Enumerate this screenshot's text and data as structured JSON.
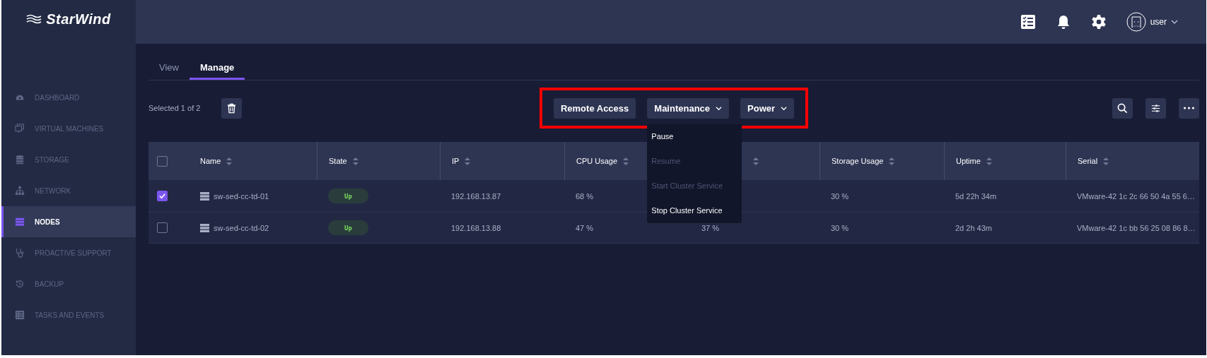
{
  "app": {
    "logo": "StarWind"
  },
  "top_bar": {
    "user": "user"
  },
  "sidebar": {
    "items": [
      {
        "label": "DASHBOARD",
        "kind": "dashboard",
        "selected": false
      },
      {
        "label": "VIRTUAL MACHINES",
        "kind": "monitors",
        "selected": false
      },
      {
        "label": "STORAGE",
        "kind": "database",
        "selected": false
      },
      {
        "label": "NETWORK",
        "kind": "network",
        "selected": false
      },
      {
        "label": "NODES",
        "kind": "server",
        "selected": true
      },
      {
        "label": "PROACTIVE SUPPORT",
        "kind": "stethoscope",
        "selected": false
      },
      {
        "label": "BACKUP",
        "kind": "history",
        "selected": false
      },
      {
        "label": "TASKS AND EVENTS",
        "kind": "list",
        "selected": false
      }
    ]
  },
  "tabs": [
    {
      "label": "View",
      "selected": false
    },
    {
      "label": "Manage",
      "selected": true
    }
  ],
  "toolbar": {
    "selection": "Selected 1 of 2",
    "actions": [
      {
        "label": "Remote Access",
        "kind": "plain"
      },
      {
        "label": "Maintenance",
        "kind": "dropdown",
        "menu": [
          {
            "label": "Pause",
            "disabled": false
          },
          {
            "label": "Resume",
            "disabled": true
          },
          {
            "label": "Start Cluster Service",
            "disabled": true
          },
          {
            "label": "Stop Cluster Service",
            "disabled": false
          }
        ]
      },
      {
        "label": "Power",
        "kind": "dropdown"
      }
    ]
  },
  "table": {
    "all_checked": false,
    "columns": [
      {
        "label": "Name"
      },
      {
        "label": "State"
      },
      {
        "label": "IP"
      },
      {
        "label": "CPU Usage"
      },
      {},
      {
        "label": "Storage Usage"
      },
      {
        "label": "Uptime"
      },
      {
        "label": "Serial"
      }
    ],
    "rows": [
      {
        "checked": true,
        "cells": [
          "sw-sed-cc-td-01",
          "Up",
          "192.168.13.87",
          "68 %",
          null,
          "30 %",
          "5d 22h 34m",
          "VMware-42 1c 2c 66 50 4a 55 6…"
        ]
      },
      {
        "checked": false,
        "cells": [
          "sw-sed-cc-td-02",
          "Up",
          "192.168.13.88",
          "47 %",
          "37 %",
          "30 %",
          "2d 2h 43m",
          "VMware-42 1c bb 56 25 08 86 8…"
        ]
      }
    ]
  }
}
